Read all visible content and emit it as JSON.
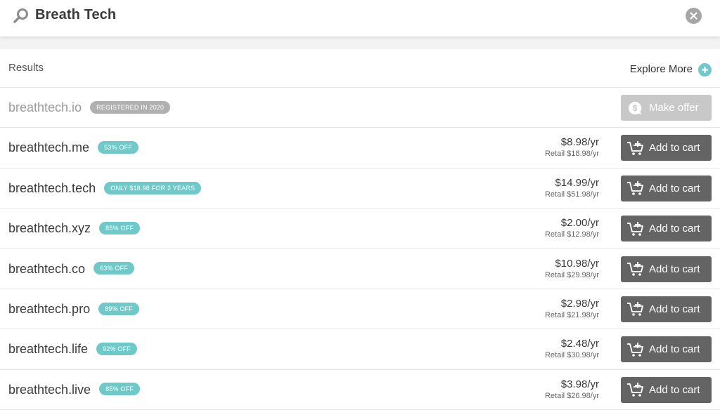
{
  "search": {
    "query": "Breath Tech"
  },
  "results": {
    "header_label": "Results",
    "explore_more_label": "Explore More",
    "rows": [
      {
        "domain": "breathtech.io",
        "badge": "REGISTERED IN 2020",
        "status": "registered",
        "price": "",
        "retail": "",
        "action_label": "Make offer"
      },
      {
        "domain": "breathtech.me",
        "badge": "53% OFF",
        "status": "available",
        "price": "$8.98/yr",
        "retail": "Retail $18.98/yr",
        "action_label": "Add to cart"
      },
      {
        "domain": "breathtech.tech",
        "badge": "ONLY $18.98 FOR 2 YEARS",
        "status": "available",
        "price": "$14.99/yr",
        "retail": "Retail $51.98/yr",
        "action_label": "Add to cart"
      },
      {
        "domain": "breathtech.xyz",
        "badge": "85% OFF",
        "status": "available",
        "price": "$2.00/yr",
        "retail": "Retail $12.98/yr",
        "action_label": "Add to cart"
      },
      {
        "domain": "breathtech.co",
        "badge": "63% OFF",
        "status": "available",
        "price": "$10.98/yr",
        "retail": "Retail $29.98/yr",
        "action_label": "Add to cart"
      },
      {
        "domain": "breathtech.pro",
        "badge": "89% OFF",
        "status": "available",
        "price": "$2.98/yr",
        "retail": "Retail $21.98/yr",
        "action_label": "Add to cart"
      },
      {
        "domain": "breathtech.life",
        "badge": "92% OFF",
        "status": "available",
        "price": "$2.48/yr",
        "retail": "Retail $30.98/yr",
        "action_label": "Add to cart"
      },
      {
        "domain": "breathtech.live",
        "badge": "85% OFF",
        "status": "available",
        "price": "$3.98/yr",
        "retail": "Retail $26.98/yr",
        "action_label": "Add to cart"
      }
    ]
  },
  "icons": {
    "search": "magnifier-icon",
    "clear": "close-icon",
    "explore": "plus-icon",
    "cart": "cart-plus-icon",
    "offer": "dollar-chat-icon"
  },
  "colors": {
    "accent": "#6fc9c9",
    "button": "#646464",
    "button_disabled": "#c8c8c8",
    "registered_badge": "#b0b0b0"
  }
}
